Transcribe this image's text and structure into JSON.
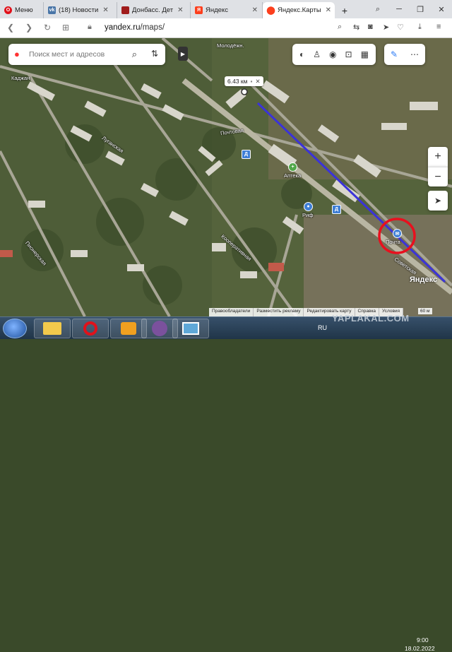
{
  "browser": {
    "tabs": [
      {
        "label": "Меню",
        "icon": "opera-icon",
        "color": "#e0121b",
        "glyph": "O"
      },
      {
        "label": "(18) Новости",
        "icon": "vk-icon",
        "color": "#4a76a8",
        "glyph": "vk"
      },
      {
        "label": "Донбасс. Дет",
        "icon": "news-site-icon",
        "color": "#a01c1c",
        "glyph": "▮"
      },
      {
        "label": "Яндекс",
        "icon": "yandex-icon",
        "color": "#fc3f1d",
        "glyph": "Я"
      },
      {
        "label": "Яндекс.Карты",
        "icon": "yandex-maps-pin-icon",
        "color": "#fc3f1d",
        "glyph": "●"
      }
    ],
    "new_tab_label": "+",
    "url_domain": "yandex.ru",
    "url_path": "/maps/"
  },
  "map": {
    "search_placeholder": "Поиск мест и адресов",
    "distance_label": "6.43 км",
    "labels": [
      {
        "text": "Молодёжн.",
        "kind": "street"
      },
      {
        "text": "Почтовая",
        "kind": "street"
      },
      {
        "text": "Аптека",
        "kind": "poi"
      },
      {
        "text": "Риф",
        "kind": "poi"
      },
      {
        "text": "Почта",
        "kind": "poi"
      },
      {
        "text": "Каджан",
        "kind": "place"
      },
      {
        "text": "Луганская",
        "kind": "street"
      },
      {
        "text": "Кооперативная",
        "kind": "street"
      },
      {
        "text": "Пионерская",
        "kind": "street"
      },
      {
        "text": "Советская",
        "kind": "street"
      }
    ],
    "brand": "Яндекс",
    "footer_links": [
      "Правообладатели",
      "Разместить рекламу",
      "Редактировать карту",
      "Справка",
      "Условия"
    ],
    "scale_label": "60 м",
    "zoom_in": "+",
    "zoom_out": "−",
    "route_color": "#3b33d9",
    "marker_color": "#e8101e"
  },
  "taskbar": {
    "lang": "RU",
    "date": "18.02.2022",
    "time": "9:00",
    "watermark": "YAPLAKAL.COM"
  }
}
